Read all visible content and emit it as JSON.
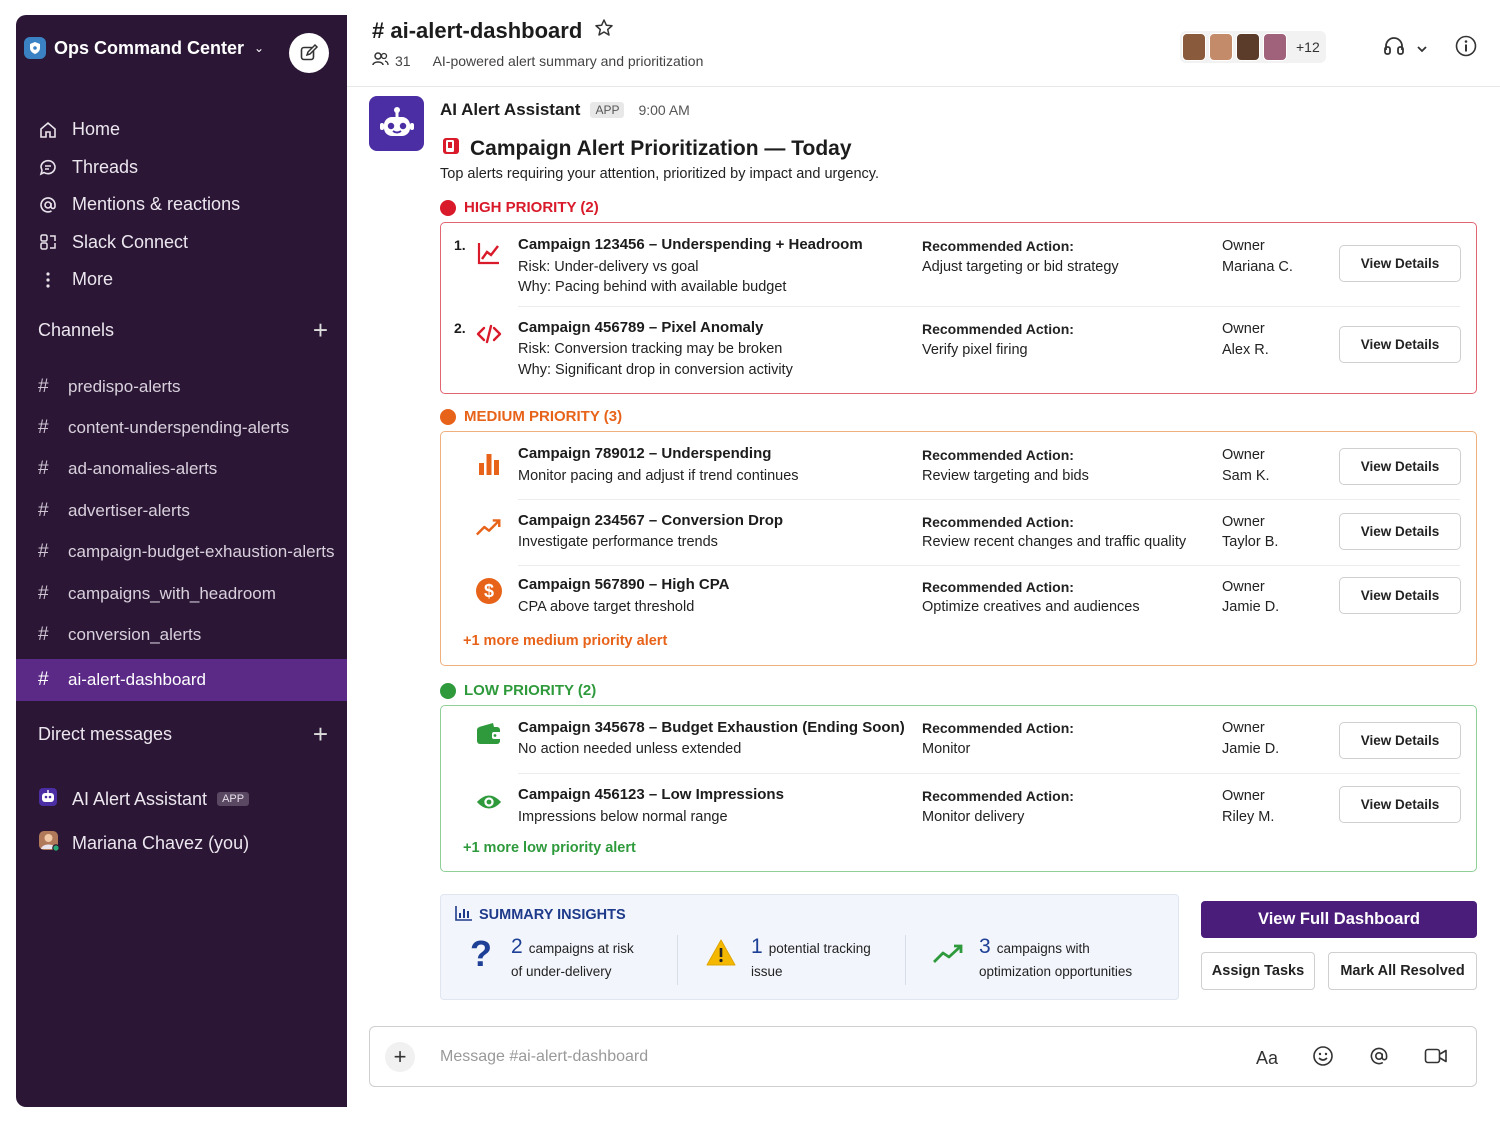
{
  "workspace": {
    "name": "Ops Command Center"
  },
  "nav": [
    {
      "label": "Home",
      "icon": "home-icon"
    },
    {
      "label": "Threads",
      "icon": "threads-icon"
    },
    {
      "label": "Mentions & reactions",
      "icon": "at-icon"
    },
    {
      "label": "Slack Connect",
      "icon": "connect-icon"
    },
    {
      "label": "More",
      "icon": "more-icon"
    }
  ],
  "channels_header": "Channels",
  "channels": [
    "predispo-alerts",
    "content-underspending-alerts",
    "ad-anomalies-alerts",
    "advertiser-alerts",
    "campaign-budget-exhaustion-alerts",
    "campaigns_with_headroom",
    "conversion_alerts",
    "ai-alert-dashboard"
  ],
  "dm_header": "Direct messages",
  "dms": [
    {
      "name": "AI Alert Assistant",
      "badge": "APP"
    },
    {
      "name": "Mariana Chavez (you)"
    }
  ],
  "channel": {
    "title": "# ai-alert-dashboard",
    "members": "31",
    "description": "AI-powered alert summary and prioritization",
    "extra_members": "+12"
  },
  "message": {
    "sender": "AI Alert Assistant",
    "badge": "APP",
    "time": "9:00 AM",
    "title": "Campaign Alert Prioritization — Today",
    "intro": "Top alerts requiring your attention, prioritized by impact and urgency.",
    "ra_label": "Recommended Action:",
    "owner_label": "Owner",
    "button_label": "View Details"
  },
  "high": {
    "label": "HIGH PRIORITY (2)",
    "color": "#d91a2a",
    "items": [
      {
        "num": "1.",
        "icon": "trend-chart-icon",
        "title": "Campaign 123456 – Underspending + Headroom",
        "line1": "Risk: Under-delivery vs goal",
        "line2": "Why: Pacing behind with available budget",
        "action": "Adjust targeting or bid strategy",
        "owner": "Mariana C."
      },
      {
        "num": "2.",
        "icon": "code-icon",
        "title": "Campaign 456789 – Pixel Anomaly",
        "line1": "Risk: Conversion tracking may be broken",
        "line2": "Why: Significant drop in conversion activity",
        "action": "Verify pixel firing",
        "owner": "Alex R."
      }
    ]
  },
  "medium": {
    "label": "MEDIUM PRIORITY (3)",
    "color": "#e8631a",
    "items": [
      {
        "icon": "bar-chart-icon",
        "title": "Campaign 789012 – Underspending",
        "line1": "Monitor pacing and adjust if trend continues",
        "action": "Review targeting and bids",
        "owner": "Sam K."
      },
      {
        "icon": "trend-up-icon",
        "title": "Campaign 234567 – Conversion Drop",
        "line1": "Investigate performance trends",
        "action": "Review recent changes and traffic quality",
        "owner": "Taylor B."
      },
      {
        "icon": "dollar-icon",
        "title": "Campaign 567890 – High CPA",
        "line1": "CPA above target threshold",
        "action": "Optimize creatives and audiences",
        "owner": "Jamie D."
      }
    ],
    "more": "+1 more medium priority alert"
  },
  "low": {
    "label": "LOW PRIORITY (2)",
    "color": "#2e9a3c",
    "items": [
      {
        "icon": "wallet-icon",
        "title": "Campaign 345678 – Budget Exhaustion (Ending Soon)",
        "line1": "No action needed unless extended",
        "action": "Monitor",
        "owner": "Jamie D."
      },
      {
        "icon": "eye-icon",
        "title": "Campaign 456123 – Low Impressions",
        "line1": "Impressions below normal range",
        "action": "Monitor delivery",
        "owner": "Riley M."
      }
    ],
    "more": "+1 more low priority alert"
  },
  "summary": {
    "title": "SUMMARY INSIGHTS",
    "stats": [
      {
        "num": "2",
        "text1": "campaigns at risk",
        "text2": "of under-delivery",
        "icon": "question-icon"
      },
      {
        "num": "1",
        "text1": "potential tracking",
        "text2": "issue",
        "icon": "warning-icon"
      },
      {
        "num": "3",
        "text1": "campaigns with",
        "text2": "optimization opportunities",
        "icon": "trend-up-icon"
      }
    ]
  },
  "actions": {
    "primary": "View Full Dashboard",
    "assign": "Assign Tasks",
    "resolve": "Mark All Resolved"
  },
  "composer": {
    "placeholder": "Message #ai-alert-dashboard",
    "format": "Aa"
  }
}
